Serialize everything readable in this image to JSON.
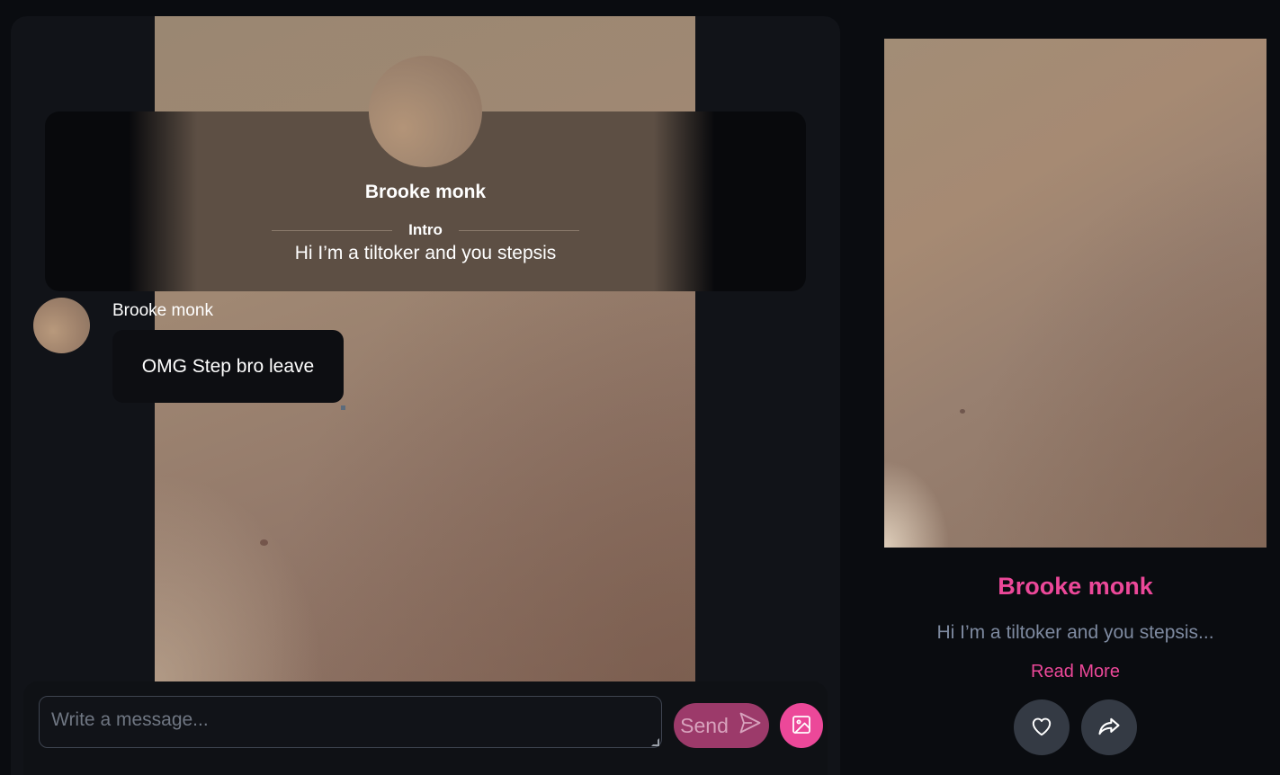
{
  "chat": {
    "intro": {
      "name": "Brooke monk",
      "label": "Intro",
      "text": "Hi I’m a tiltoker and you stepsis"
    },
    "messages": [
      {
        "author": "Brooke monk",
        "text": "OMG Step bro leave"
      }
    ],
    "composer": {
      "placeholder": "Write a message...",
      "value": "",
      "send_label": "Send",
      "send_icon": "send-icon",
      "image_icon": "image-icon"
    }
  },
  "profile": {
    "name": "Brooke monk",
    "bio": "Hi I’m a tiltoker and you stepsis...",
    "read_more_label": "Read More",
    "like_icon": "heart-icon",
    "share_icon": "share-icon"
  },
  "colors": {
    "accent": "#ec4899",
    "background": "#0a0c10",
    "panel": "#111318",
    "bio_text": "#7e8aa0"
  }
}
